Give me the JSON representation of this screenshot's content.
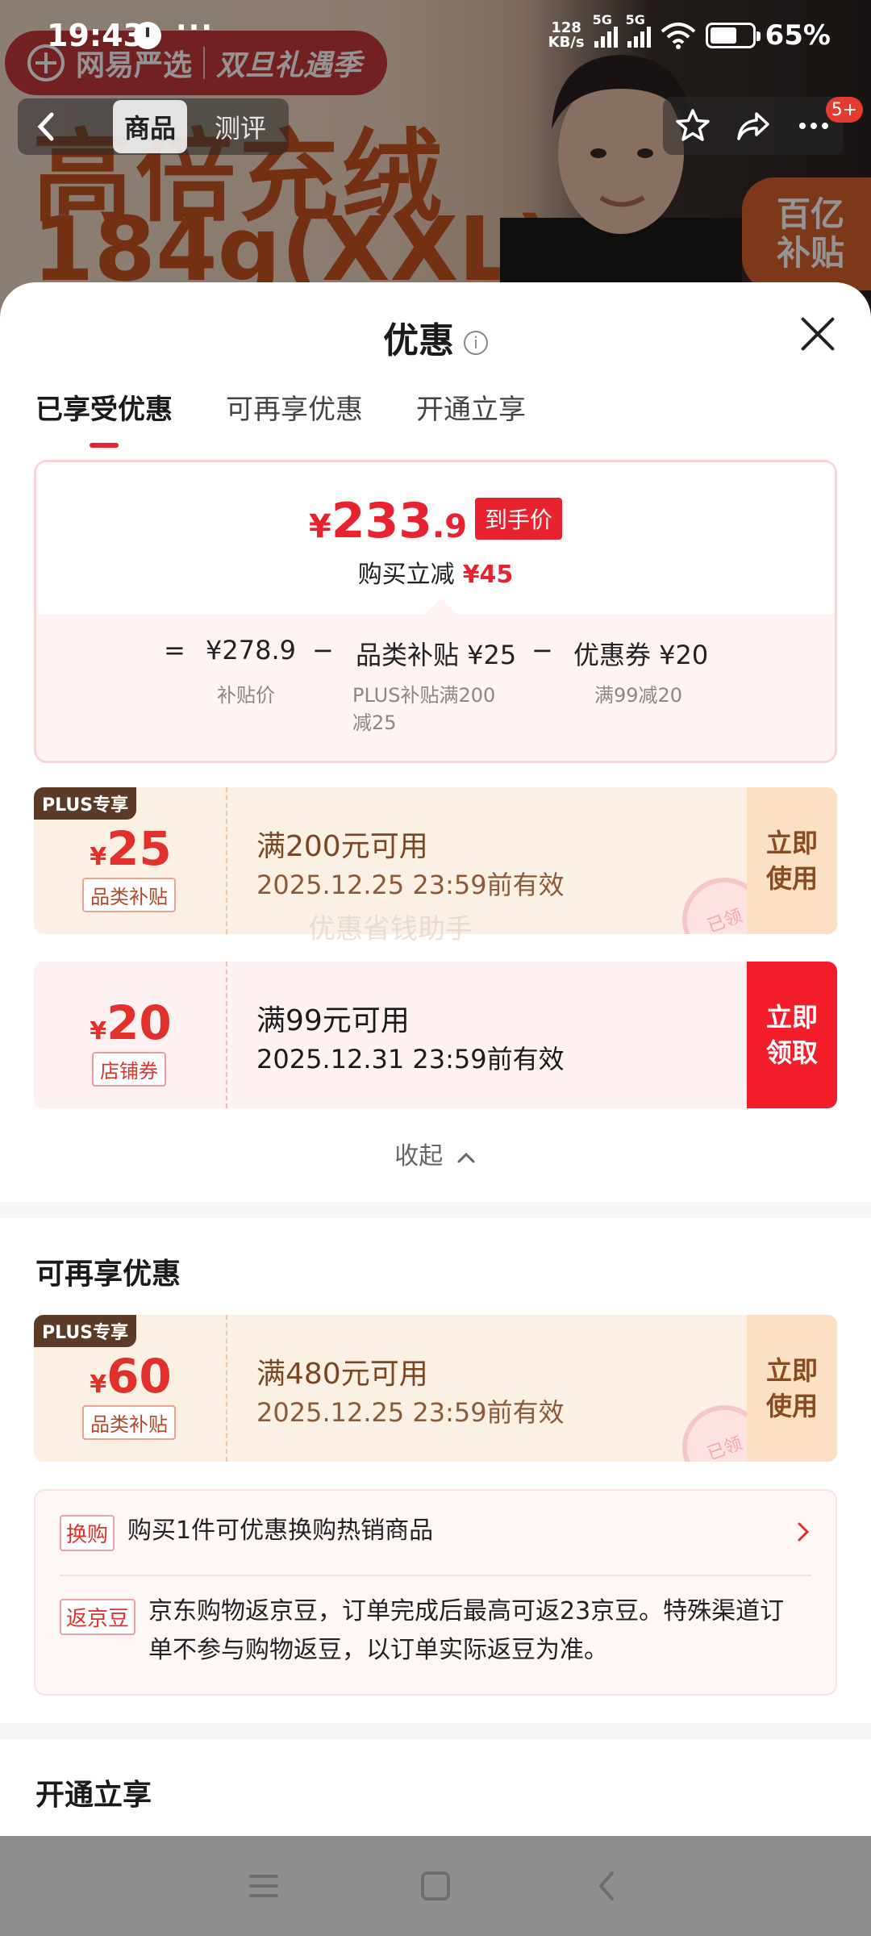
{
  "status_bar": {
    "time": "19:43",
    "more": "···",
    "net_speed_value": "128",
    "net_speed_unit": "KB/s",
    "network1": "5G",
    "network2": "5G",
    "battery": "65%"
  },
  "banner": {
    "brand": "网易严选",
    "campaign": "双旦礼遇季",
    "headline_1": "高倍充绒",
    "headline_2": "184g(XXL)",
    "subsidy_line1": "百亿",
    "subsidy_line2": "补贴"
  },
  "nav": {
    "tabs": [
      "商品",
      "测评"
    ],
    "badge": "5+"
  },
  "sheet": {
    "title": "优惠",
    "info_icon": "i",
    "tabs": [
      "已享受优惠",
      "可再享优惠",
      "开通立享"
    ]
  },
  "price": {
    "currency": "¥",
    "integer": "233",
    "decimal": ".9",
    "tag": "到手价",
    "reduce_label": "购买立减",
    "reduce_amount": "¥45",
    "formula": {
      "eq": "=",
      "subsidy_price": "¥278.9",
      "subsidy_price_label": "补贴价",
      "minus": "−",
      "category": "品类补贴 ¥25",
      "category_note_1": "PLUS补贴满200",
      "category_note_2": "减25",
      "coupon": "优惠券 ¥20",
      "coupon_note": "满99减20"
    }
  },
  "coupons_enjoyed": [
    {
      "plus_tag": "PLUS专享",
      "currency": "¥",
      "amount": "25",
      "kind": "品类补贴",
      "condition": "满200元可用",
      "expiry": "2025.12.25 23:59前有效",
      "action_1": "立即",
      "action_2": "使用",
      "stamp": "已领"
    },
    {
      "currency": "¥",
      "amount": "20",
      "kind": "店铺券",
      "condition": "满99元可用",
      "expiry": "2025.12.31 23:59前有效",
      "action_1": "立即",
      "action_2": "领取"
    }
  ],
  "watermark": "优惠省钱助手",
  "collapse_label": "收起",
  "more_section": {
    "title": "可再享优惠",
    "coupon": {
      "plus_tag": "PLUS专享",
      "currency": "¥",
      "amount": "60",
      "kind": "品类补贴",
      "condition": "满480元可用",
      "expiry": "2025.12.25 23:59前有效",
      "action_1": "立即",
      "action_2": "使用",
      "stamp": "已领"
    },
    "exchange_tag": "换购",
    "exchange_text": "购买1件可优惠换购热销商品",
    "bean_tag": "返京豆",
    "bean_text_1": "京东购物返京豆，订单完成后最高可返23京豆。特殊渠道订",
    "bean_text_2": "单不参与购物返豆，以订单实际返豆为准。"
  },
  "open_section": {
    "title": "开通立享"
  },
  "colors": {
    "accent_red": "#e8232f",
    "plus_brown": "#5b3b28",
    "coupon_beige": "#fcf0e4",
    "coupon_pink": "#fdf1f1"
  }
}
